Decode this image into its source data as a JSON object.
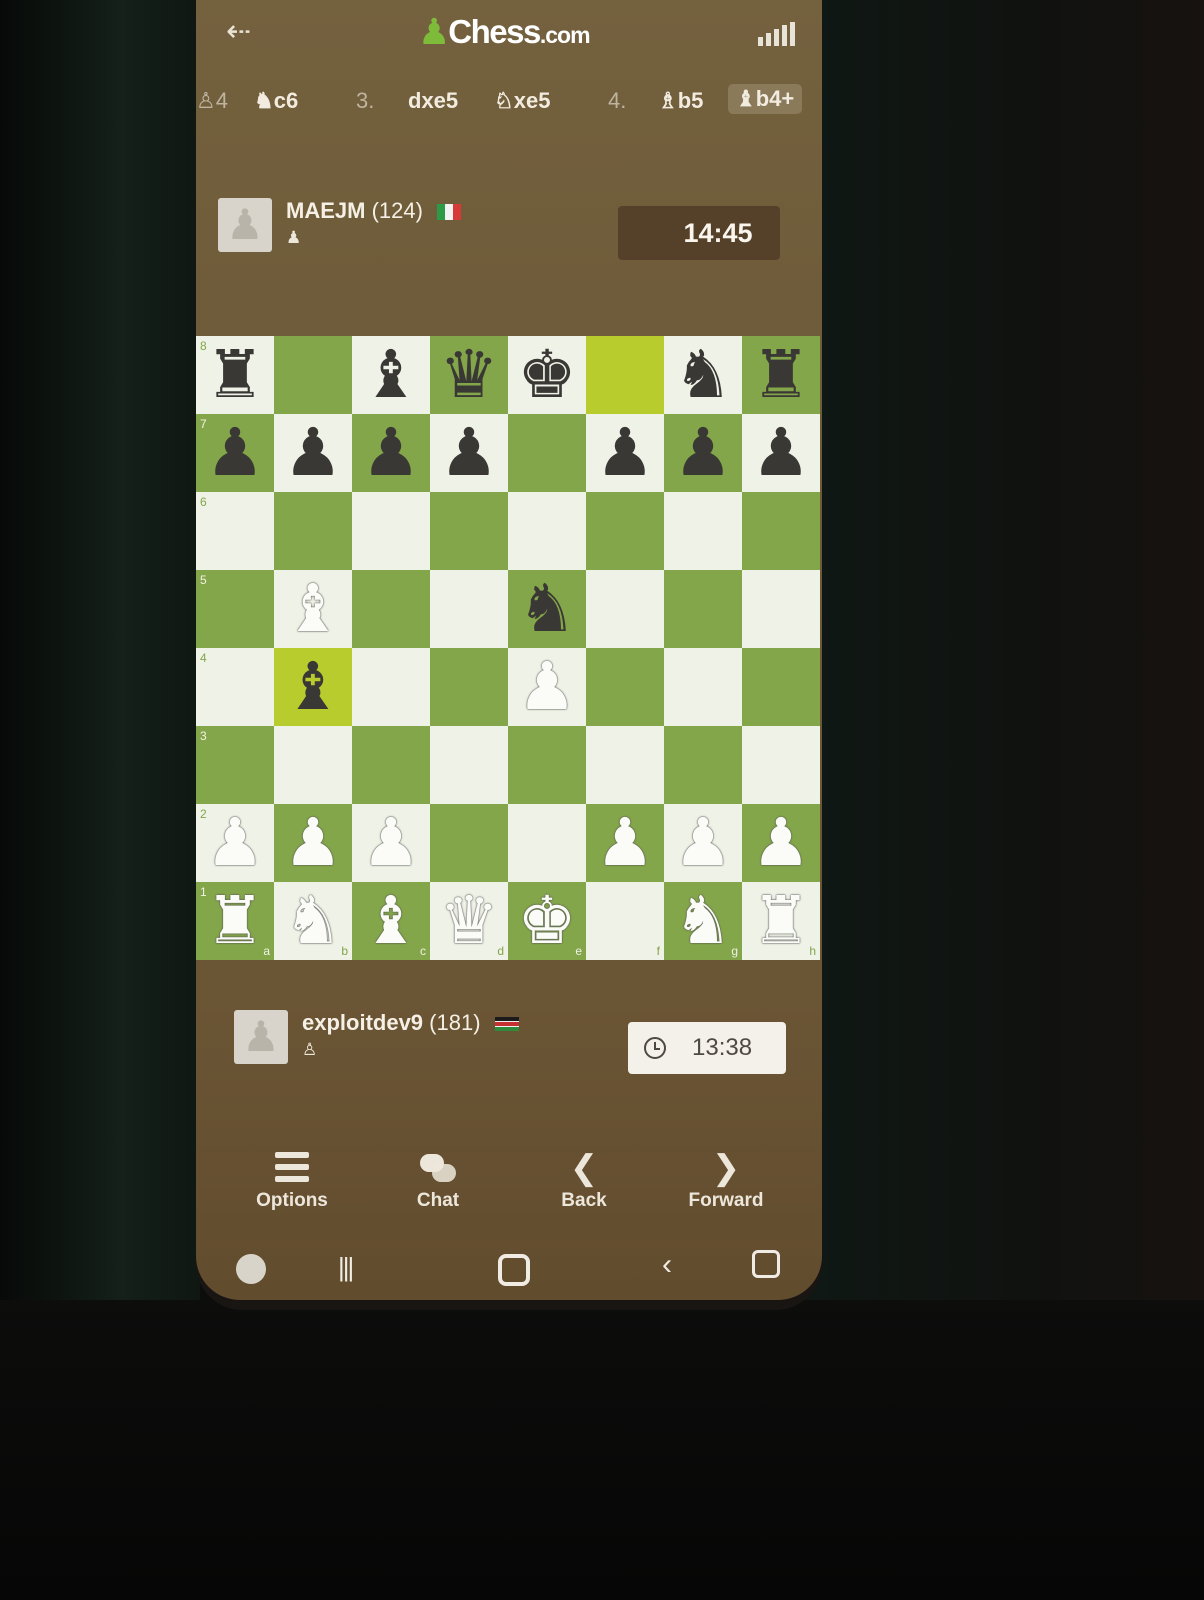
{
  "app": {
    "brand": "Chess",
    "brand_suffix": ".com"
  },
  "header": {
    "back_icon": "arrow-left-icon",
    "signal_icon": "signal-bars-icon"
  },
  "moves": [
    {
      "num": "",
      "text": "♞c6",
      "partial_left": "♙4"
    },
    {
      "num": "3.",
      "text": "dxe5"
    },
    {
      "num": "",
      "text": "♘xe5"
    },
    {
      "num": "4.",
      "text": "♗b5"
    },
    {
      "num": "",
      "text": "♝b4+"
    }
  ],
  "opponent": {
    "name": "MAEJM",
    "rating": "(124)",
    "flag": "Italy",
    "clock": "14:45"
  },
  "player": {
    "name": "exploitdev9",
    "rating": "(181)",
    "flag": "Kenya",
    "clock": "13:38"
  },
  "board": {
    "orientation": "white",
    "highlight": [
      "f8",
      "b4"
    ],
    "ranks": [
      "8",
      "7",
      "6",
      "5",
      "4",
      "3",
      "2",
      "1"
    ],
    "files": [
      "a",
      "b",
      "c",
      "d",
      "e",
      "f",
      "g",
      "h"
    ],
    "position": [
      [
        "r",
        "",
        "b",
        "q",
        "k",
        "",
        "n",
        "r"
      ],
      [
        "p",
        "p",
        "p",
        "p",
        "",
        "p",
        "p",
        "p"
      ],
      [
        "",
        "",
        "",
        "",
        "",
        "",
        "",
        ""
      ],
      [
        "",
        "B",
        "",
        "",
        "n",
        "",
        "",
        ""
      ],
      [
        "",
        "b",
        "",
        "",
        "P",
        "",
        "",
        ""
      ],
      [
        "",
        "",
        "",
        "",
        "",
        "",
        "",
        ""
      ],
      [
        "P",
        "P",
        "P",
        "",
        "",
        "P",
        "P",
        "P"
      ],
      [
        "R",
        "N",
        "B",
        "Q",
        "K",
        "",
        "N",
        "R"
      ]
    ]
  },
  "actions": [
    {
      "label": "Options",
      "icon": "list-icon"
    },
    {
      "label": "Chat",
      "icon": "chat-bubbles-icon"
    },
    {
      "label": "Back",
      "icon": "chevron-left-icon"
    },
    {
      "label": "Forward",
      "icon": "chevron-right-icon"
    }
  ],
  "system_nav": [
    "assistant-icon",
    "recent-apps-icon",
    "home-icon",
    "system-back-icon",
    "screenshot-icon"
  ]
}
